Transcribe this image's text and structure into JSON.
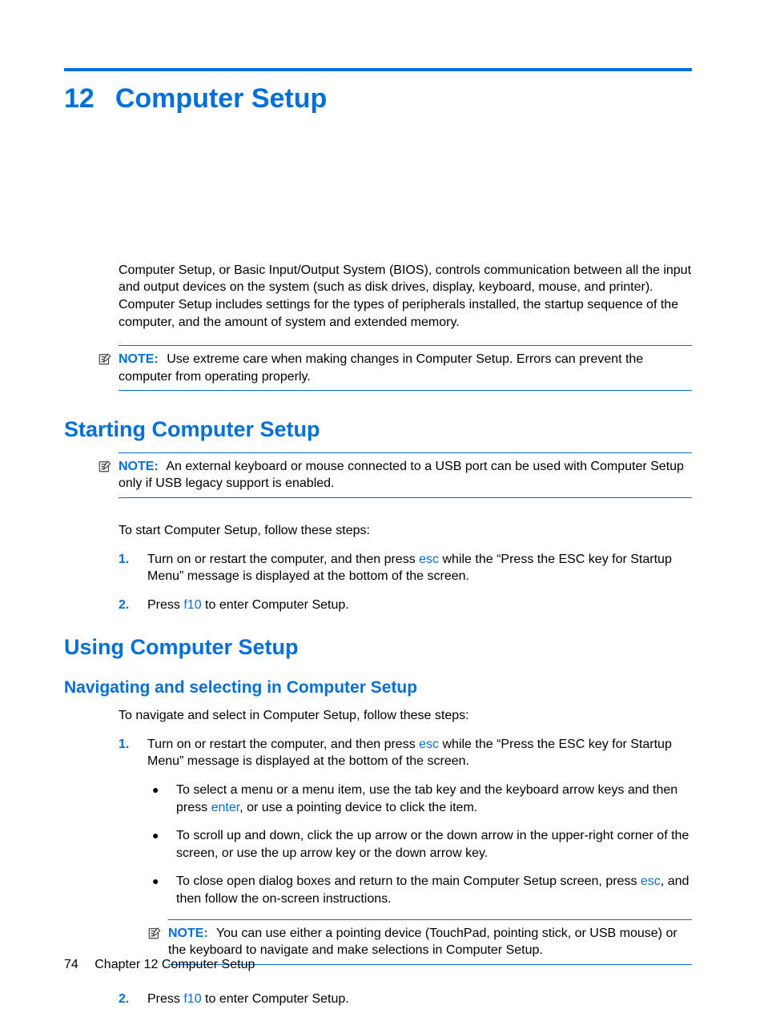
{
  "chapter": {
    "number": "12",
    "title": "Computer Setup"
  },
  "intro": "Computer Setup, or Basic Input/Output System (BIOS), controls communication between all the input and output devices on the system (such as disk drives, display, keyboard, mouse, and printer). Computer Setup includes settings for the types of peripherals installed, the startup sequence of the computer, and the amount of system and extended memory.",
  "note1": {
    "label": "NOTE:",
    "text": "Use extreme care when making changes in Computer Setup. Errors can prevent the computer from operating properly."
  },
  "section_starting": {
    "heading": "Starting Computer Setup",
    "note": {
      "label": "NOTE:",
      "text": "An external keyboard or mouse connected to a USB port can be used with Computer Setup only if USB legacy support is enabled."
    },
    "lead": "To start Computer Setup, follow these steps:",
    "steps": [
      {
        "num": "1.",
        "pre": "Turn on or restart the computer, and then press ",
        "key": "esc",
        "post": " while the “Press the ESC key for Startup Menu” message is displayed at the bottom of the screen."
      },
      {
        "num": "2.",
        "pre": "Press ",
        "key": "f10",
        "post": " to enter Computer Setup."
      }
    ]
  },
  "section_using": {
    "heading": "Using Computer Setup",
    "sub_heading": "Navigating and selecting in Computer Setup",
    "lead": "To navigate and select in Computer Setup, follow these steps:",
    "step1": {
      "num": "1.",
      "pre": "Turn on or restart the computer, and then press ",
      "key": "esc",
      "post": " while the “Press the ESC key for Startup Menu” message is displayed at the bottom of the screen.",
      "bullets": [
        {
          "pre": "To select a menu or a menu item, use the tab key and the keyboard arrow keys and then press ",
          "key": "enter",
          "post": ", or use a pointing device to click the item."
        },
        {
          "pre": "To scroll up and down, click the up arrow or the down arrow in the upper-right corner of the screen, or use the up arrow key or the down arrow key.",
          "key": "",
          "post": ""
        },
        {
          "pre": "To close open dialog boxes and return to the main Computer Setup screen, press ",
          "key": "esc",
          "post": ", and then follow the on-screen instructions."
        }
      ],
      "note": {
        "label": "NOTE:",
        "text": "You can use either a pointing device (TouchPad, pointing stick, or USB mouse) or the keyboard to navigate and make selections in Computer Setup."
      }
    },
    "step2": {
      "num": "2.",
      "pre": "Press ",
      "key": "f10",
      "post": " to enter Computer Setup."
    }
  },
  "footer": {
    "page": "74",
    "chapter_label": "Chapter 12   Computer Setup"
  }
}
